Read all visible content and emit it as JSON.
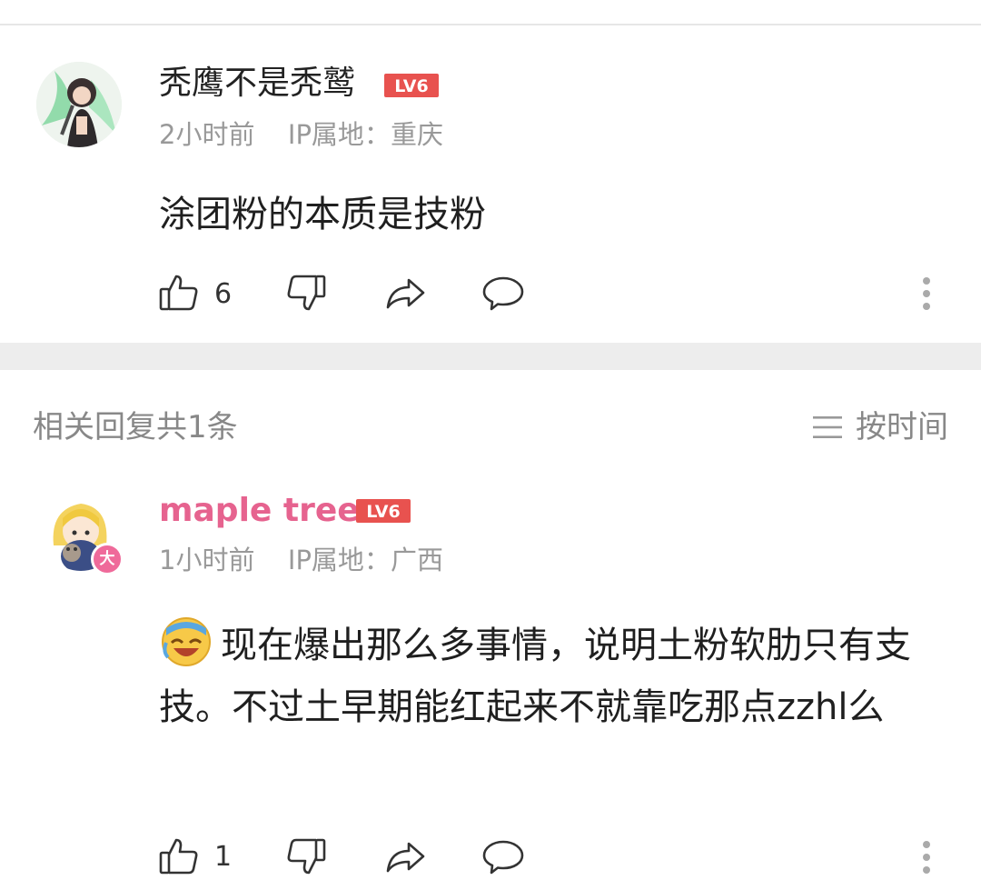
{
  "comment": {
    "username": "秃鹰不是秃鹫",
    "level_badge": "LV6",
    "time": "2小时前",
    "ip_label": "IP属地：",
    "ip_location": "重庆",
    "text": "涂团粉的本质是技粉",
    "like_count": "6"
  },
  "replies_section": {
    "title": "相关回复共1条",
    "sort_label": "按时间",
    "sort_icon": "list-icon"
  },
  "reply": {
    "username": "maple tree",
    "level_badge": "LV6",
    "role_badge": "大",
    "time": "1小时前",
    "ip_label": "IP属地：",
    "ip_location": "广西",
    "text": "现在爆出那么多事情，说明土粉软肋只有支技。不过土早期能红起来不就靠吃那点zzhl么",
    "emoji": "laughing-crying-emoji",
    "like_count": "1"
  },
  "colors": {
    "level_badge": "#e8524f",
    "reply_username": "#e6638f",
    "meta_gray": "#999999",
    "divider": "#ededed"
  }
}
